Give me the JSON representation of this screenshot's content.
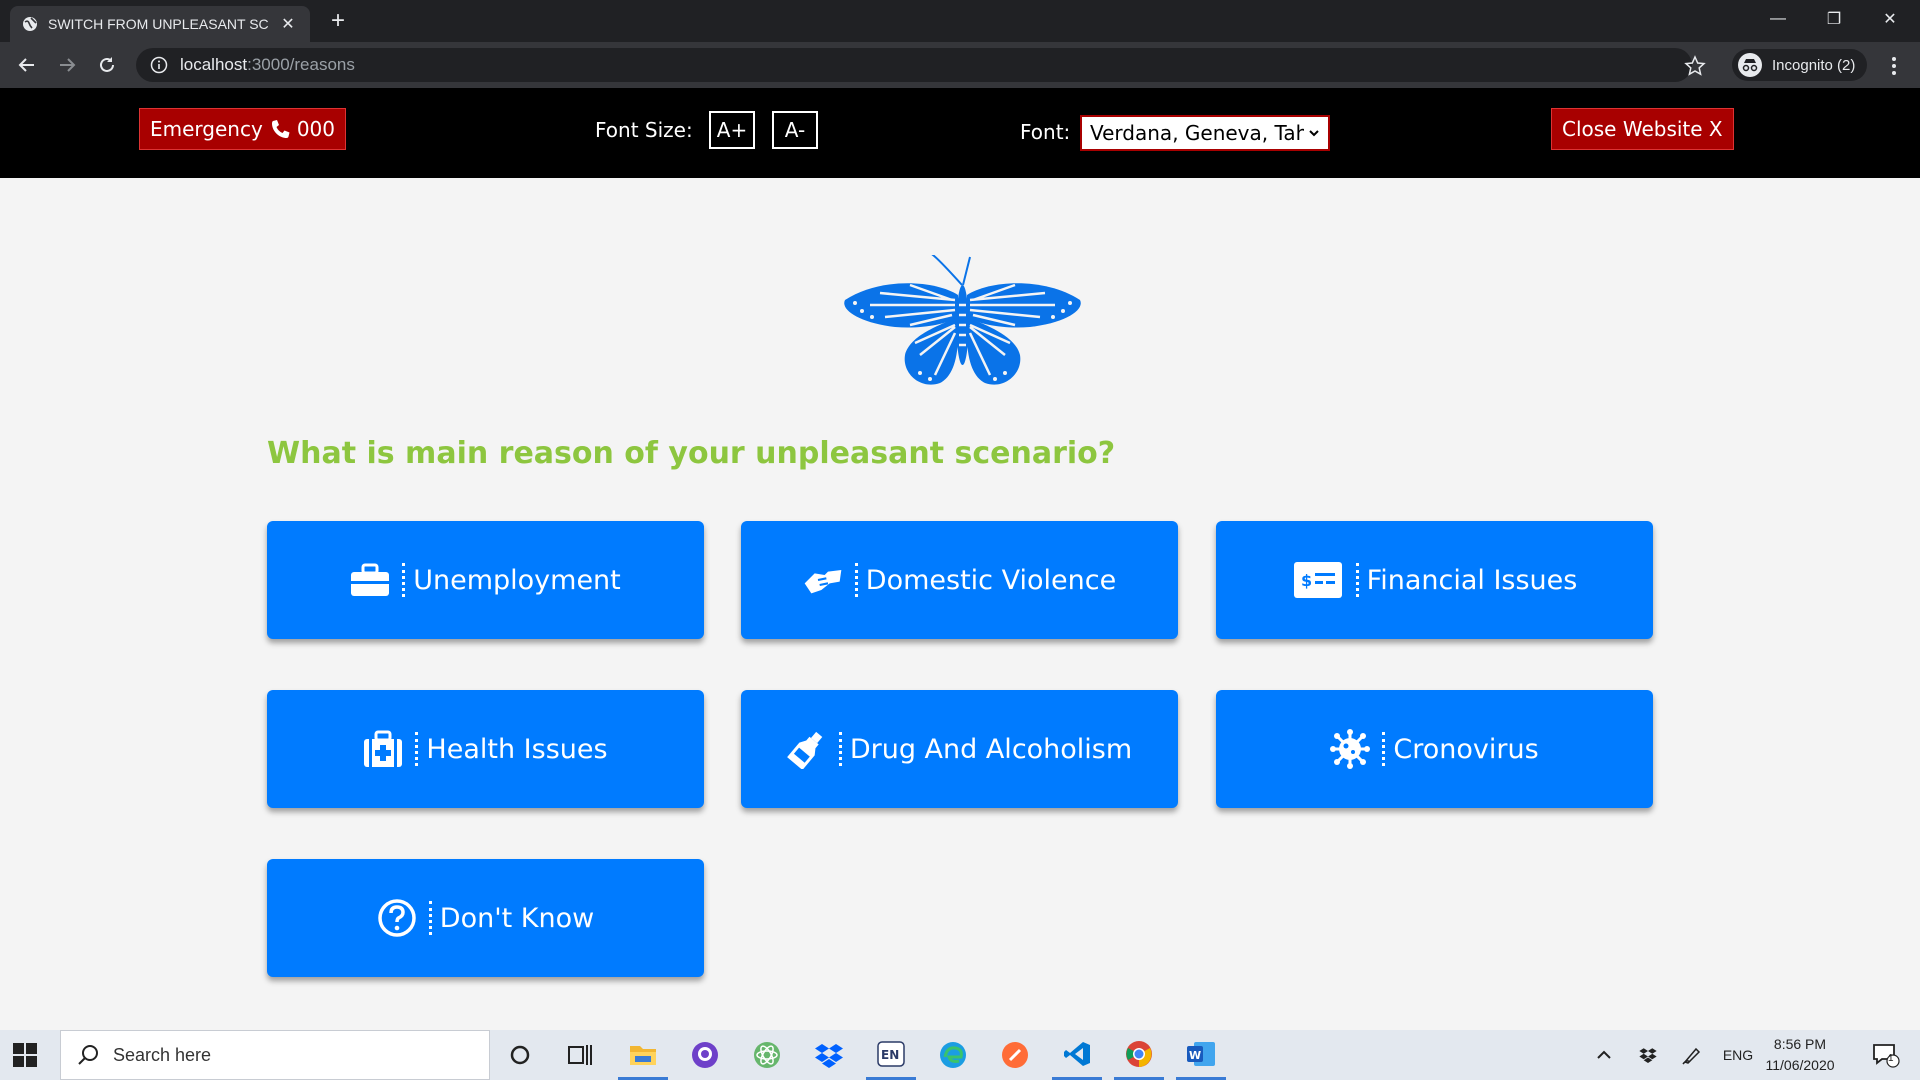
{
  "browser": {
    "tab_title": "SWITCH FROM UNPLEASANT SC",
    "url_host": "localhost",
    "url_path": ":3000/reasons",
    "incognito_label": "Incognito (2)"
  },
  "header": {
    "emergency_label": "Emergency",
    "emergency_number": "000",
    "font_size_label": "Font Size:",
    "increase_label": "A+",
    "decrease_label": "A-",
    "font_label": "Font:",
    "font_selected": "Verdana, Geneva, Tahoma, sans-serif",
    "close_label": "Close Website X",
    "accent_color": "#a80000"
  },
  "main": {
    "question": "What is main reason of your unpleasant scenario?",
    "question_color": "#8dc63f",
    "button_color": "#007bff",
    "reasons": [
      {
        "label": "Unemployment",
        "icon": "briefcase-icon"
      },
      {
        "label": "Domestic Violence",
        "icon": "handshake-icon"
      },
      {
        "label": "Financial Issues",
        "icon": "money-check-icon"
      },
      {
        "label": "Health Issues",
        "icon": "medkit-icon"
      },
      {
        "label": "Drug And Alcoholism",
        "icon": "bottle-icon"
      },
      {
        "label": "Cronovirus",
        "icon": "virus-icon"
      },
      {
        "label": "Don't Know",
        "icon": "question-circle-icon"
      }
    ]
  },
  "taskbar": {
    "search_placeholder": "Search here",
    "language": "ENG",
    "time": "8:56 PM",
    "date": "11/06/2020",
    "notification_count": "1"
  }
}
